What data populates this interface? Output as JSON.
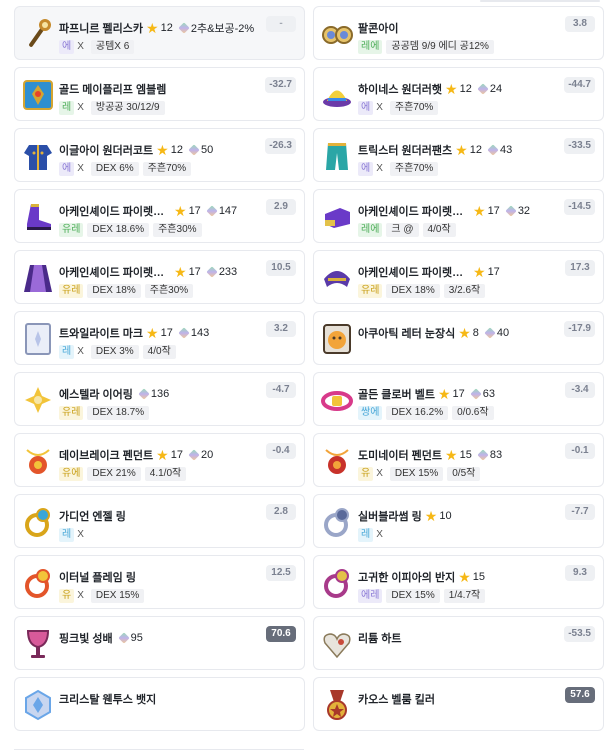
{
  "items": [
    {
      "name": "파프니르 펠리스카",
      "star": "12",
      "gem": "2추&보공-2%",
      "pot_tier": "epic",
      "pot": "에",
      "add": "X",
      "opts": [
        "공템X 6"
      ],
      "score": "-",
      "score_style": "dim",
      "active": true,
      "icon": "staff-icon",
      "c1": "#c58a2c",
      "c2": "#6a4a1a"
    },
    {
      "name": "팔콘아이",
      "star": "",
      "gem": "",
      "pot_tier": "legend",
      "pot": "레에",
      "add": "",
      "opts": [
        "공공뎀 9/9 에디 공12%"
      ],
      "score": "3.8",
      "score_style": "",
      "active": false,
      "icon": "binocular-icon",
      "c1": "#e6c36a",
      "c2": "#8a6a2a"
    },
    {
      "name": "골드 메이플리프 엠블렘",
      "star": "",
      "gem": "",
      "pot_tier": "legend",
      "pot": "레",
      "add": "X",
      "opts": [
        "방공공 30/12/9"
      ],
      "score": "-32.7",
      "score_style": "",
      "active": false,
      "icon": "emblem-icon",
      "c1": "#2f8fd0",
      "c2": "#d4a531"
    },
    {
      "name": "하이네스 원더러햇",
      "star": "12",
      "gem": "24",
      "pot_tier": "epic",
      "pot": "에",
      "add": "X",
      "opts": [
        "주흔70%"
      ],
      "score": "-44.7",
      "score_style": "",
      "active": false,
      "icon": "hat-icon",
      "c1": "#f2cf3a",
      "c2": "#6b3aa8"
    },
    {
      "name": "이글아이 원더러코트",
      "star": "12",
      "gem": "50",
      "pot_tier": "epic",
      "pot": "에",
      "add": "X",
      "opts": [
        "DEX 6%",
        "주흔70%"
      ],
      "score": "-26.3",
      "score_style": "",
      "active": false,
      "icon": "coat-icon",
      "c1": "#2b4fa8",
      "c2": "#e3b23a"
    },
    {
      "name": "트릭스터 원더러팬츠",
      "star": "12",
      "gem": "43",
      "pot_tier": "epic",
      "pot": "에",
      "add": "X",
      "opts": [
        "주흔70%"
      ],
      "score": "-33.5",
      "score_style": "",
      "active": false,
      "icon": "pants-icon",
      "c1": "#2aa6a6",
      "c2": "#e3b23a"
    },
    {
      "name": "아케인셰이드 파이렛슈즈",
      "star": "17",
      "gem": "147",
      "pot_tier": "legend",
      "pot": "유레",
      "add": "",
      "opts": [
        "DEX 18.6%",
        "주흔30%"
      ],
      "score": "2.9",
      "score_style": "",
      "active": false,
      "icon": "shoes-icon",
      "c1": "#6a3ac8",
      "c2": "#d9b23a"
    },
    {
      "name": "아케인셰이드 파이렛글러브",
      "star": "17",
      "gem": "32",
      "pot_tier": "legend",
      "pot": "레에",
      "add": "",
      "opts": [
        "크 @",
        "4/0작"
      ],
      "score": "-14.5",
      "score_style": "",
      "active": false,
      "icon": "glove-icon",
      "c1": "#6a3ac8",
      "c2": "#e3c24a"
    },
    {
      "name": "아케인셰이드 파이렛케이프",
      "star": "17",
      "gem": "233",
      "pot_tier": "unique",
      "pot": "유레",
      "add": "",
      "opts": [
        "DEX 18%",
        "주흔30%"
      ],
      "score": "10.5",
      "score_style": "",
      "active": false,
      "icon": "cape-icon",
      "c1": "#4a2a8a",
      "c2": "#9a6ad8"
    },
    {
      "name": "아케인셰이드 파이렛숄더",
      "star": "17",
      "gem": "",
      "pot_tier": "unique",
      "pot": "유레",
      "add": "",
      "opts": [
        "DEX 18%",
        "3/2.6작"
      ],
      "score": "17.3",
      "score_style": "",
      "active": false,
      "icon": "shoulder-icon",
      "c1": "#5a3aa8",
      "c2": "#d9b23a"
    },
    {
      "name": "트와일라이트 마크",
      "star": "17",
      "gem": "143",
      "pot_tier": "rare",
      "pot": "레",
      "add": "X",
      "opts": [
        "DEX 3%",
        "4/0작"
      ],
      "score": "3.2",
      "score_style": "",
      "active": false,
      "icon": "mark-icon",
      "c1": "#8a96b8",
      "c2": "#eaeef8"
    },
    {
      "name": "아쿠아틱 레터 눈장식",
      "star": "8",
      "gem": "40",
      "pot_tier": "",
      "pot": "",
      "add": "",
      "opts": [],
      "score": "-17.9",
      "score_style": "",
      "active": false,
      "icon": "eye-accessory-icon",
      "c1": "#f2a43a",
      "c2": "#4a3a2a"
    },
    {
      "name": "에스텔라 이어링",
      "star": "",
      "gem": "136",
      "pot_tier": "unique",
      "pot": "유레",
      "add": "",
      "opts": [
        "DEX 18.7%"
      ],
      "score": "-4.7",
      "score_style": "",
      "active": false,
      "icon": "earring-icon",
      "c1": "#f2c43a",
      "c2": "#f6e6a8"
    },
    {
      "name": "골든 클로버 벨트",
      "star": "17",
      "gem": "63",
      "pot_tier": "rare",
      "pot": "쌍에",
      "add": "",
      "opts": [
        "DEX 16.2%",
        "0/0.6작"
      ],
      "score": "-3.4",
      "score_style": "",
      "active": false,
      "icon": "belt-icon",
      "c1": "#d83a8a",
      "c2": "#f2c43a"
    },
    {
      "name": "데이브레이크 펜던트",
      "star": "17",
      "gem": "20",
      "pot_tier": "unique",
      "pot": "유에",
      "add": "",
      "opts": [
        "DEX 21%",
        "4.1/0작"
      ],
      "score": "-0.4",
      "score_style": "",
      "active": false,
      "icon": "pendant-icon",
      "c1": "#e3552a",
      "c2": "#f2c43a"
    },
    {
      "name": "도미네이터 펜던트",
      "star": "15",
      "gem": "83",
      "pot_tier": "unique",
      "pot": "유",
      "add": "X",
      "opts": [
        "DEX 15%",
        "0/5작"
      ],
      "score": "-0.1",
      "score_style": "",
      "active": false,
      "icon": "pendant-icon",
      "c1": "#c8322a",
      "c2": "#f2a43a"
    },
    {
      "name": "가디언 엔젤 링",
      "star": "",
      "gem": "",
      "pot_tier": "rare",
      "pot": "레",
      "add": "X",
      "opts": [],
      "score": "2.8",
      "score_style": "",
      "active": false,
      "icon": "ring-icon",
      "c1": "#d9a51a",
      "c2": "#3aa6d8"
    },
    {
      "name": "실버블라썸 링",
      "star": "10",
      "gem": "",
      "pot_tier": "rare",
      "pot": "레",
      "add": "X",
      "opts": [],
      "score": "-7.7",
      "score_style": "",
      "active": false,
      "icon": "ring-icon",
      "c1": "#9aa6c8",
      "c2": "#5a6a9a"
    },
    {
      "name": "이터널 플레임 링",
      "star": "",
      "gem": "",
      "pot_tier": "unique",
      "pot": "유",
      "add": "X",
      "opts": [
        "DEX 15%"
      ],
      "score": "12.5",
      "score_style": "",
      "active": false,
      "icon": "ring-icon",
      "c1": "#e3552a",
      "c2": "#f2c43a"
    },
    {
      "name": "고귀한 이피아의 반지",
      "star": "15",
      "gem": "",
      "pot_tier": "epic",
      "pot": "에레",
      "add": "",
      "opts": [
        "DEX 15%",
        "1/4.7작"
      ],
      "score": "9.3",
      "score_style": "",
      "active": false,
      "icon": "ring-icon",
      "c1": "#a83a8a",
      "c2": "#e3c24a"
    },
    {
      "name": "핑크빛 성배",
      "star": "",
      "gem": "95",
      "pot_tier": "",
      "pot": "",
      "add": "",
      "opts": [],
      "score": "70.6",
      "score_style": "dark",
      "active": false,
      "icon": "chalice-icon",
      "c1": "#d85a9a",
      "c2": "#7a2a5a"
    },
    {
      "name": "리튬 하트",
      "star": "",
      "gem": "",
      "pot_tier": "",
      "pot": "",
      "add": "",
      "opts": [],
      "score": "-53.5",
      "score_style": "",
      "active": false,
      "icon": "heart-icon",
      "c1": "#e8e4dc",
      "c2": "#c84a3a"
    },
    {
      "name": "크리스탈 웬투스 뱃지",
      "star": "",
      "gem": "",
      "pot_tier": "",
      "pot": "",
      "add": "",
      "opts": [],
      "score": "",
      "score_style": "",
      "active": false,
      "icon": "badge-icon",
      "c1": "#6aa6e8",
      "c2": "#c8d6f0"
    },
    {
      "name": "카오스 벨룸 킬러",
      "star": "",
      "gem": "",
      "pot_tier": "",
      "pot": "",
      "add": "",
      "opts": [],
      "score": "57.6",
      "score_style": "dark",
      "active": false,
      "icon": "medal-icon",
      "c1": "#a8382a",
      "c2": "#e3b23a"
    }
  ]
}
